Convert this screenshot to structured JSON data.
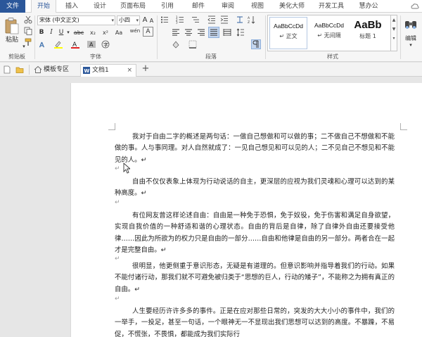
{
  "menu": {
    "file": "文件",
    "tabs": [
      "开始",
      "插入",
      "设计",
      "页面布局",
      "引用",
      "邮件",
      "审阅",
      "视图",
      "美化大师",
      "开发工具",
      "慧办公"
    ]
  },
  "ribbon": {
    "clipboard": {
      "paste": "粘贴",
      "label": "剪贴板"
    },
    "font": {
      "name": "宋体 (中文正文)",
      "size": "小四",
      "bold": "B",
      "italic": "I",
      "underline": "U",
      "strike": "abc",
      "subscript": "x₂",
      "superscript": "x²",
      "grow": "A",
      "shrink": "A",
      "aa": "Aa",
      "wen": "wén",
      "clear": "A",
      "label": "字体"
    },
    "paragraph": {
      "label": "段落"
    },
    "styles": {
      "items": [
        {
          "sample": "AaBbCcDd",
          "name": "↵ 正文"
        },
        {
          "sample": "AaBbCcDd",
          "name": "↵ 无间隔"
        },
        {
          "sample": "AaBb",
          "name": "标题 1"
        }
      ],
      "label": "样式"
    },
    "editing": {
      "label": "编辑"
    }
  },
  "doctabs": {
    "template": "模板专区",
    "document": "文档1",
    "add": "+"
  },
  "document": {
    "paragraphs": [
      "我对于自由二字的概述是两句话：一做自己想做和可以做的事；二不做自己不想做和不能做的事。人与事同理。对人自然就成了：一见自己想见和可以见的人；二不见自己不想见和不能见的人。↵",
      "自由不仅仅表象上体现为行动说话的自主，更深层的应视为我们灵魂和心理可以达到的某种高度。↵",
      "有位网友曾这样论述自由：自由是一种免于恐惧，免于奴役，免于伤害和满足自身欲望，实现自我价值的一种舒适和谐的心理状态。自由的背后是自律，除了自律外自由还要接受他律……因此为所欲为的权力只是自由的一部分……自由和他律是自由的另一部分。两者合在一起才是完整自由。↵",
      "很明显，他更侧重于意识形态，无疑是有道理的。但意识影响并指导着我们的行动。如果不能付诸行动，那我们就不可避免被归类于“思想的巨人，行动的矮子”，不能称之为拥有真正的自由。↵",
      "人生要经历许许多多的事件。正是在应对那些日常的，突发的大大小小的事件中，我们的一举手，一投足，甚至一句话，一个眼神无一不显现出我们思想可以达到的高度。不暴躁，不易促，不慌张，不畏惧，都能成为我们实际行"
    ],
    "empty_mark": "↵"
  }
}
